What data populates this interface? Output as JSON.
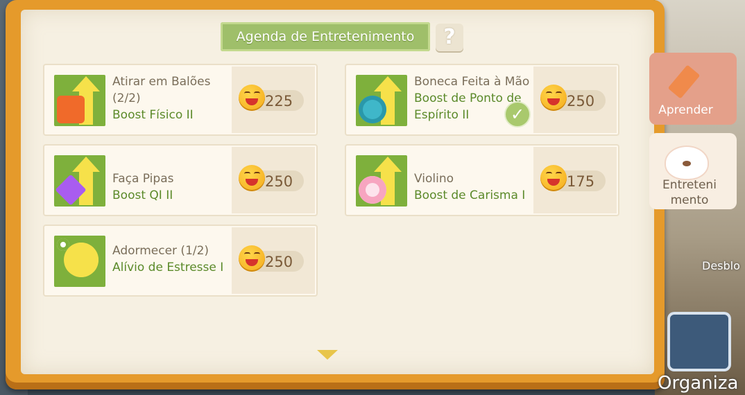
{
  "title": "Agenda de Entretenimento",
  "help_symbol": "?",
  "colors": {
    "book_frame": "#e59a2b",
    "page": "#f6f0e2",
    "header_green": "#9fbf6a",
    "boost_text": "#5b8a2a",
    "thumb_bg": "#7eb03c"
  },
  "activities": [
    {
      "name": "Atirar em Balões (2/2)",
      "boost": "Boost Físico II",
      "cost": "225",
      "icon": "balloon-target-icon",
      "done": false
    },
    {
      "name": "Boneca Feita à Mão",
      "boost": "Boost de Ponto de Espírito II",
      "cost": "250",
      "icon": "yarn-ball-icon",
      "done": true
    },
    {
      "name": "Faça Pipas",
      "boost": "Boost QI II",
      "cost": "250",
      "icon": "kite-icon",
      "done": false
    },
    {
      "name": "Violino",
      "boost": "Boost de Carisma I",
      "cost": "175",
      "icon": "flower-icon",
      "done": false
    },
    {
      "name": "Adormecer (1/2)",
      "boost": "Alívio de Estresse I",
      "cost": "250",
      "icon": "moon-icon",
      "done": false
    }
  ],
  "side_tabs": {
    "learn": "Aprender",
    "entertainment": "Entreteni mento"
  },
  "right_labels": {
    "unlock": "Desblo",
    "organize": "Organiza"
  },
  "icons": {
    "mood_coin": "grinning-face-icon",
    "check": "checkmark-icon",
    "scroll": "chevron-down-icon"
  }
}
